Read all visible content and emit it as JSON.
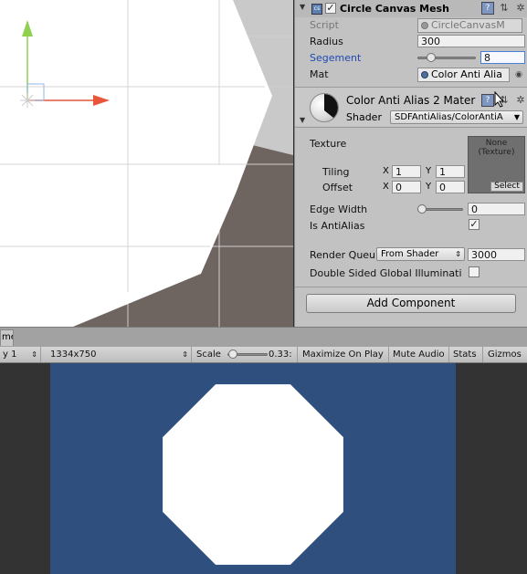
{
  "inspector": {
    "component": {
      "title": "Circle Canvas Mesh",
      "enabled": true,
      "fields": {
        "script_label": "Script",
        "script_value": "CircleCanvasM",
        "radius_label": "Radius",
        "radius_value": "300",
        "segment_label": "Segement",
        "segment_value": "8",
        "segment_slider_fraction": 0.1,
        "mat_label": "Mat",
        "mat_value": "Color Anti Alia"
      }
    },
    "material": {
      "title": "Color Anti Alias 2 Mater",
      "shader_label": "Shader",
      "shader_value": "SDFAntiAlias/ColorAntiA",
      "texture_label": "Texture",
      "texture_slot_line1": "None",
      "texture_slot_line2": "(Texture)",
      "texture_select": "Select",
      "tiling_label": "Tiling",
      "offset_label": "Offset",
      "x_label": "X",
      "y_label": "Y",
      "tiling_x": "1",
      "tiling_y": "1",
      "offset_x": "0",
      "offset_y": "0",
      "edge_width_label": "Edge Width",
      "edge_width_value": "0",
      "edge_width_slider_fraction": 0.0,
      "is_antialias_label": "Is AntiAlias",
      "is_antialias_checked": true,
      "render_queue_label": "Render Queu",
      "render_queue_dropdown": "From Shader",
      "render_queue_value": "3000",
      "double_sided_label": "Double Sided Global Illuminati",
      "double_sided_checked": false
    },
    "add_component_label": "Add Component"
  },
  "game": {
    "tab_label": "me",
    "toolbar": {
      "display_label": "y 1",
      "resolution": "1334x750",
      "scale_label": "Scale",
      "scale_value": "0.33:",
      "maximize_on_play": "Maximize On Play",
      "mute_audio": "Mute Audio",
      "stats": "Stats",
      "gizmos": "Gizmos"
    },
    "canvas_color": "#2f4f7f",
    "shape_color": "#ffffff"
  },
  "scene": {
    "ground_color": "#6e6460",
    "sky_color": "#c9c9c9",
    "gizmo_y_color": "#8fd14f",
    "gizmo_x_color": "#e8553a"
  },
  "icons": {
    "component_icon": "script-icon",
    "help": "help-icon",
    "settings": "gear-icon",
    "preset": "sliders-icon",
    "material_preview": "sphere-icon",
    "fold": "triangle-down-icon",
    "cursor": "mouse-cursor-icon"
  }
}
